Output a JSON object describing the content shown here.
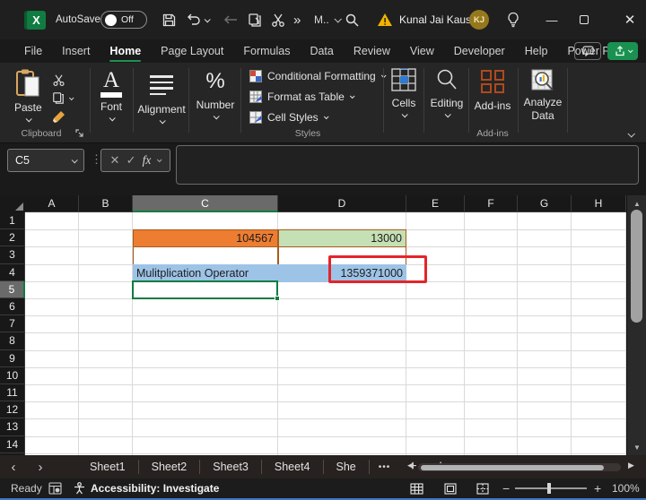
{
  "titlebar": {
    "autosave_label": "AutoSave",
    "autosave_state": "Off",
    "overflow_label": "»",
    "more_label": "M..",
    "user_name": "Kunal Jai Kaushik",
    "user_initials": "KJ"
  },
  "menubar": {
    "items": [
      "File",
      "Insert",
      "Home",
      "Page Layout",
      "Formulas",
      "Data",
      "Review",
      "View",
      "Developer",
      "Help",
      "Power Pivot"
    ],
    "active": "Home"
  },
  "ribbon": {
    "paste_label": "Paste",
    "clipboard_group": "Clipboard",
    "font_label": "Font",
    "alignment_label": "Alignment",
    "number_label": "Number",
    "styles_items": [
      "Conditional Formatting",
      "Format as Table",
      "Cell Styles"
    ],
    "styles_group": "Styles",
    "cells_label": "Cells",
    "editing_label": "Editing",
    "addins_label": "Add-ins",
    "addins_group": "Add-ins",
    "analyze_label": "Analyze Data"
  },
  "formula_bar": {
    "name_box": "C5",
    "fx_label": "fx",
    "formula": ""
  },
  "grid": {
    "columns": [
      "A",
      "B",
      "C",
      "D",
      "E",
      "F",
      "G",
      "H"
    ],
    "row_count": 15,
    "selected_column": "C",
    "selected_row": 5,
    "selection_ref": "C5",
    "selection_color": "#107C41",
    "cells": [
      {
        "ref": "C2",
        "value": "104567",
        "align": "right",
        "bg": "#ED7D31",
        "border": "#A85B1E"
      },
      {
        "ref": "D2",
        "value": "13000",
        "align": "right",
        "bg": "#C5E0B4",
        "border": "#A85B1E"
      },
      {
        "ref": "C3",
        "value": "",
        "align": "left",
        "bg": "#FFFFFF",
        "border": "#A85B1E"
      },
      {
        "ref": "D3",
        "value": "",
        "align": "left",
        "bg": "#FFFFFF",
        "border": "#A85B1E"
      },
      {
        "ref": "C4",
        "value": "Mulitplication Operator",
        "align": "left",
        "bg": "#9DC3E6",
        "border": ""
      },
      {
        "ref": "D4",
        "value": "1359371000",
        "align": "right",
        "bg": "#9DC3E6",
        "border": ""
      }
    ],
    "annotation": {
      "target": "D4",
      "color": "#E3242B"
    }
  },
  "sheet_tabs": {
    "tabs": [
      "Sheet1",
      "Sheet2",
      "Sheet3",
      "Sheet4",
      "She"
    ],
    "more": "•••",
    "add": "+",
    "menu": "⋮"
  },
  "status_bar": {
    "ready": "Ready",
    "accessibility": "Accessibility: Investigate",
    "zoom": "100%"
  }
}
